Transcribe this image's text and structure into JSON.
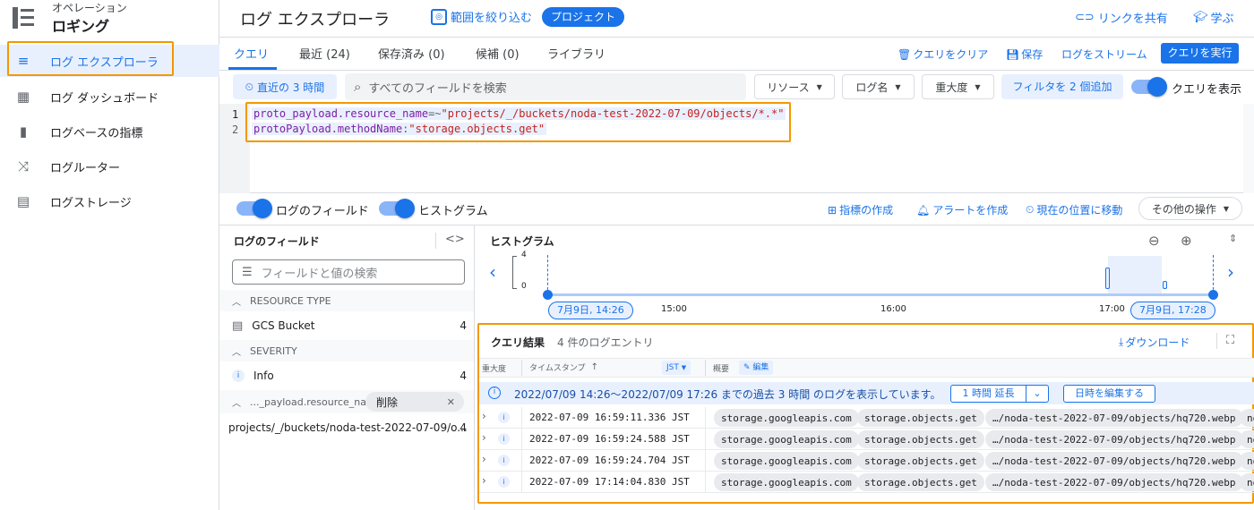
{
  "sidebar": {
    "header_sub": "オペレーション",
    "header_title": "ロギング",
    "items": [
      {
        "label": "ログ エクスプローラ",
        "icon": "list-icon"
      },
      {
        "label": "ログ ダッシュボード",
        "icon": "dashboard-icon"
      },
      {
        "label": "ログベースの指標",
        "icon": "bar-chart-icon"
      },
      {
        "label": "ログルーター",
        "icon": "shuffle-icon"
      },
      {
        "label": "ログストレージ",
        "icon": "storage-icon"
      }
    ]
  },
  "header": {
    "title": "ログ エクスプローラ",
    "scope_label": "範囲を絞り込む",
    "project_chip": "プロジェクト",
    "share_link": "リンクを共有",
    "learn": "学ぶ"
  },
  "tabs": [
    {
      "label": "クエリ"
    },
    {
      "label": "最近 (24)"
    },
    {
      "label": "保存済み (0)"
    },
    {
      "label": "候補 (0)"
    },
    {
      "label": "ライブラリ"
    }
  ],
  "actions": {
    "clear_query": "クエリをクリア",
    "save": "保存",
    "stream": "ログをストリーム",
    "run_query": "クエリを実行"
  },
  "filter_bar": {
    "time_range": "直近の 3 時間",
    "search_placeholder": "すべてのフィールドを検索",
    "resource": "リソース",
    "log_name": "ログ名",
    "severity": "重大度",
    "add_filter": "フィルタを 2 個追加",
    "show_query": "クエリを表示"
  },
  "query_editor": {
    "lines": [
      {
        "num": "1",
        "key": "proto_payload.resource_name",
        "op": "=~",
        "value": "\"projects/_/buckets/noda-test-2022-07-09/objects/*.*\""
      },
      {
        "num": "2",
        "key": "protoPayload.methodName",
        "op": ":",
        "value": "\"storage.objects.get\""
      }
    ]
  },
  "toolbar2": {
    "log_fields_toggle": "ログのフィールド",
    "histogram_toggle": "ヒストグラム",
    "create_metric": "指標の作成",
    "create_alert": "アラートを作成",
    "jump_now": "現在の位置に移動",
    "more_actions": "その他の操作"
  },
  "log_fields": {
    "title": "ログのフィールド",
    "search_placeholder": "フィールドと値の検索",
    "sections": [
      {
        "header": "RESOURCE TYPE",
        "items": [
          {
            "label": "GCS Bucket",
            "count": "4"
          }
        ]
      },
      {
        "header": "SEVERITY",
        "items": [
          {
            "label": "Info",
            "count": "4"
          }
        ]
      },
      {
        "header": "..._payload.resource_name",
        "remove": "削除",
        "items": [
          {
            "label": "projects/_/buckets/noda-test-2022-07-09/o...",
            "count": "4"
          }
        ]
      }
    ]
  },
  "histogram": {
    "title": "ヒストグラム",
    "y_max": "4",
    "y_min": "0",
    "start_label": "7月9日, 14:26",
    "end_label": "7月9日, 17:28",
    "ticks": [
      "15:00",
      "16:00",
      "17:00"
    ]
  },
  "results": {
    "title": "クエリ結果",
    "count": "4 件のログエントリ",
    "download": "ダウンロード",
    "col_severity": "重大度",
    "col_timestamp": "タイムスタンプ",
    "timezone": "JST",
    "col_summary": "概要",
    "edit": "編集",
    "info_text": "2022/07/09 14:26〜2022/07/09 17:26 までの過去 3 時間 のログを表示しています。",
    "extend": "1 時間 延長",
    "edit_time": "日時を編集する",
    "rows": [
      {
        "severity": "i",
        "timestamp": "2022-07-09 16:59:11.336 JST",
        "service": "storage.googleapis.com",
        "method": "storage.objects.get",
        "resource": "…/noda-test-2022-07-09/objects/hq720.webp",
        "more": "no"
      },
      {
        "severity": "i",
        "timestamp": "2022-07-09 16:59:24.588 JST",
        "service": "storage.googleapis.com",
        "method": "storage.objects.get",
        "resource": "…/noda-test-2022-07-09/objects/hq720.webp",
        "more": "no"
      },
      {
        "severity": "i",
        "timestamp": "2022-07-09 16:59:24.704 JST",
        "service": "storage.googleapis.com",
        "method": "storage.objects.get",
        "resource": "…/noda-test-2022-07-09/objects/hq720.webp",
        "more": "no"
      },
      {
        "severity": "i",
        "timestamp": "2022-07-09 17:14:04.830 JST",
        "service": "storage.googleapis.com",
        "method": "storage.objects.get",
        "resource": "…/noda-test-2022-07-09/objects/hq720.webp",
        "more": "no"
      }
    ]
  }
}
